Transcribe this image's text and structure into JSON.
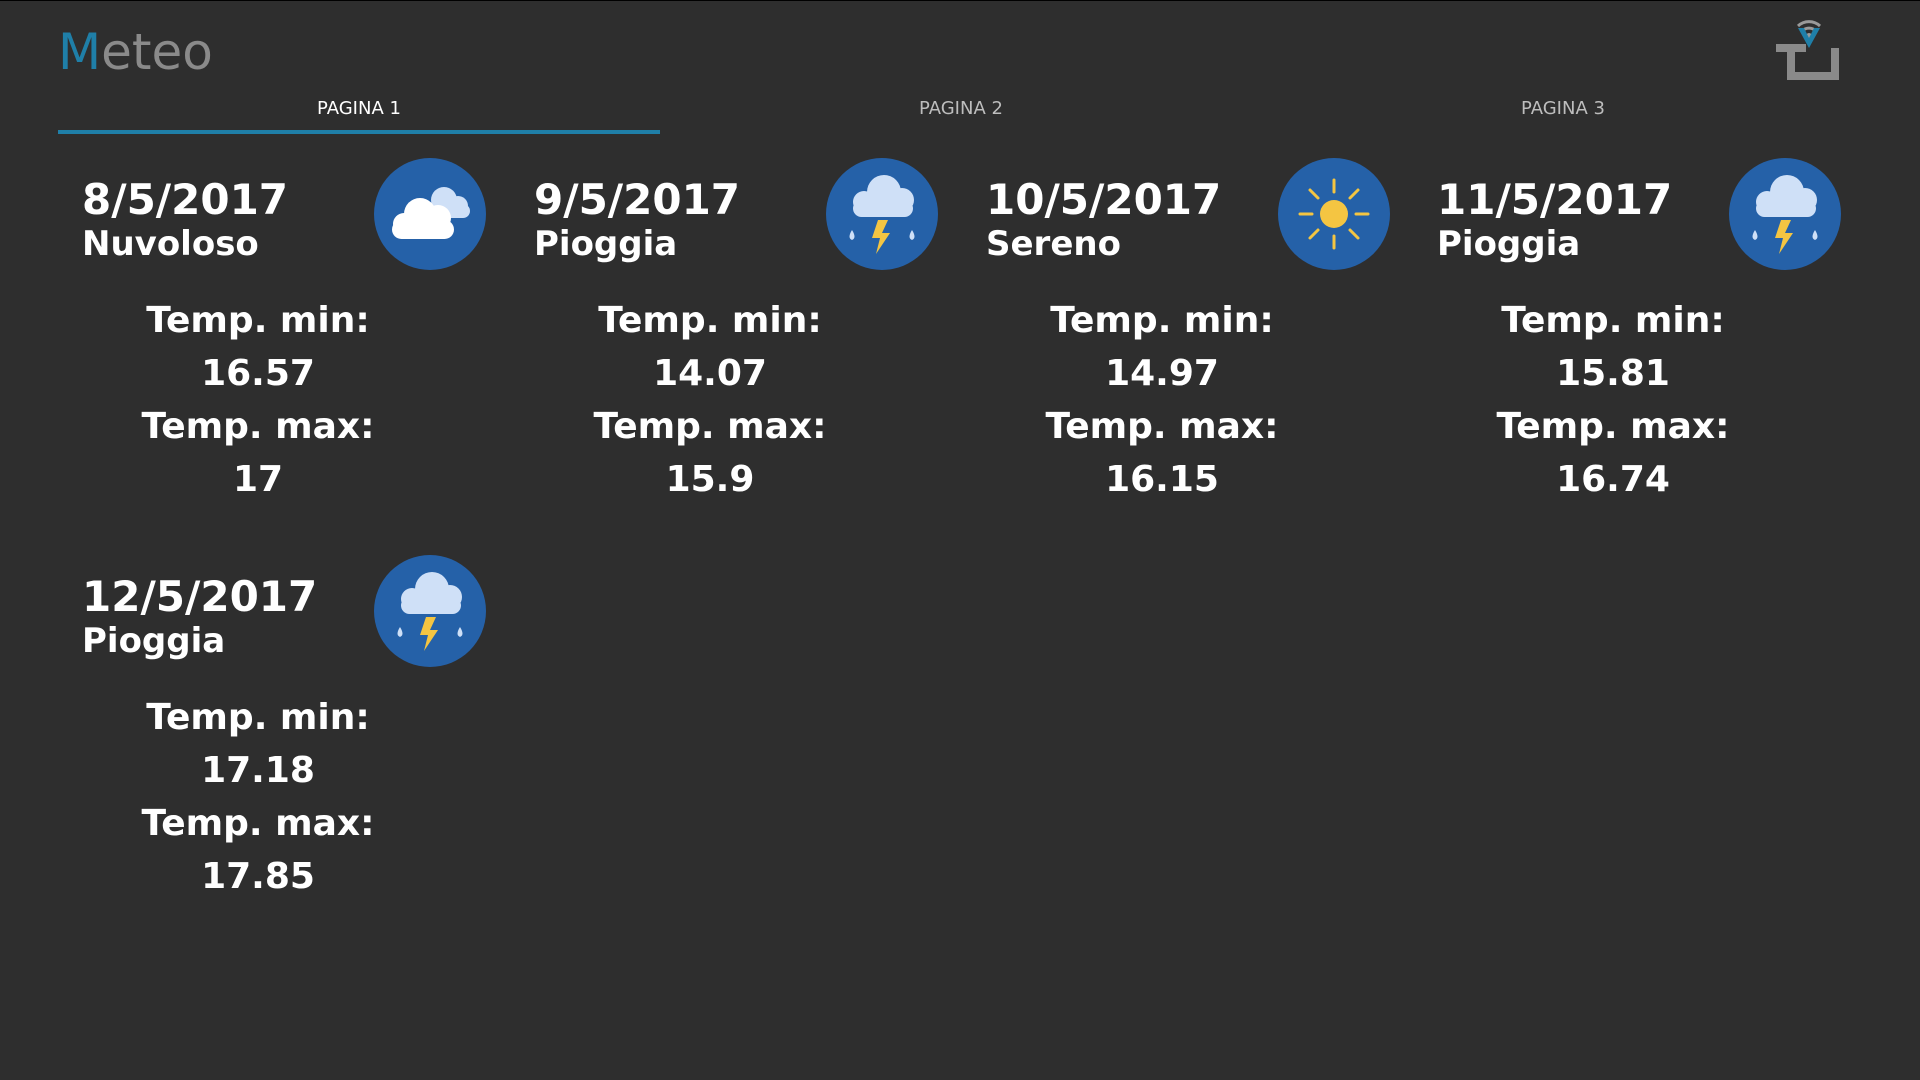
{
  "app": {
    "title_first_letter": "M",
    "title_rest": "eteo"
  },
  "colors": {
    "background": "#2e2e2e",
    "accent": "#1f7fa8",
    "icon_circle": "#2561a8",
    "sun": "#f4c542",
    "cloud_light": "#cfe0f7"
  },
  "tabs": [
    {
      "label": "PAGINA 1",
      "active": true
    },
    {
      "label": "PAGINA 2",
      "active": false
    },
    {
      "label": "PAGINA 3",
      "active": false
    }
  ],
  "labels": {
    "temp_min": "Temp. min:",
    "temp_max": "Temp. max:"
  },
  "forecast": [
    {
      "date": "8/5/2017",
      "condition": "Nuvoloso",
      "icon": "cloudy-icon",
      "min": "16.57",
      "max": "17"
    },
    {
      "date": "9/5/2017",
      "condition": "Pioggia",
      "icon": "rain-storm-icon",
      "min": "14.07",
      "max": "15.9"
    },
    {
      "date": "10/5/2017",
      "condition": "Sereno",
      "icon": "sun-icon",
      "min": "14.97",
      "max": "16.15"
    },
    {
      "date": "11/5/2017",
      "condition": "Pioggia",
      "icon": "rain-storm-icon",
      "min": "15.81",
      "max": "16.74"
    },
    {
      "date": "12/5/2017",
      "condition": "Pioggia",
      "icon": "rain-storm-icon",
      "min": "17.18",
      "max": "17.85"
    }
  ]
}
